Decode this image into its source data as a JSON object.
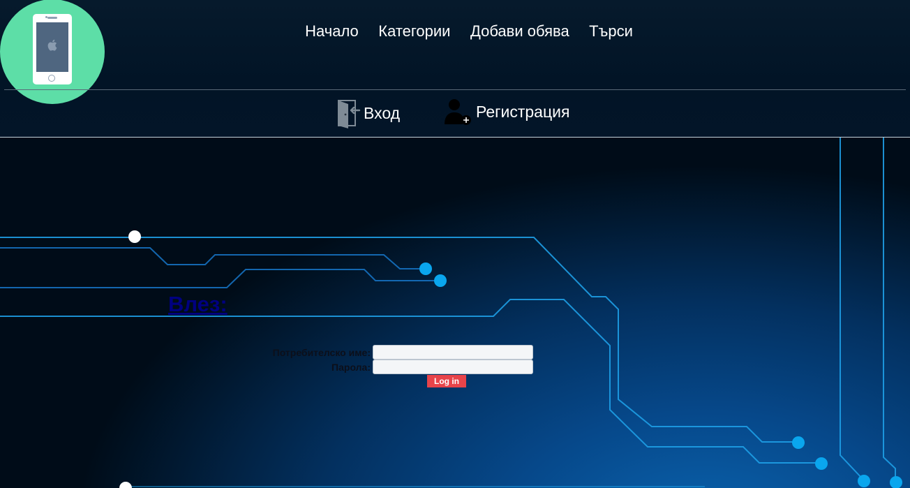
{
  "logo": {
    "icon": "smartphone-apple-icon"
  },
  "topnav": {
    "items": [
      {
        "label": "Начало"
      },
      {
        "label": "Категории"
      },
      {
        "label": "Добави обява"
      },
      {
        "label": "Търси"
      }
    ]
  },
  "authnav": {
    "login": {
      "label": "Вход",
      "icon": "login-door-icon"
    },
    "register": {
      "label": "Регистрация",
      "icon": "add-user-icon"
    }
  },
  "login_form": {
    "title": "Влез:",
    "username_label": "Потребителско име:",
    "username_value": "",
    "password_label": "Парола:",
    "password_value": "",
    "submit_label": "Log in"
  },
  "colors": {
    "logo_bg": "#5ddea7",
    "header_bg": "#021426",
    "button_bg": "#e8444a",
    "title_color": "#000080",
    "circuit_line": "#1e9fe6"
  }
}
